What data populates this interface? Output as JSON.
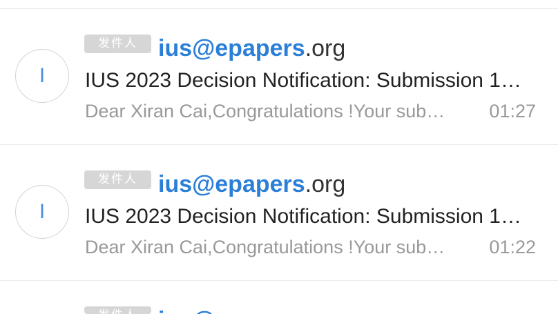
{
  "colors": {
    "accent": "#2b7fd8",
    "avatar_letter": "#4a8fdc",
    "avatar_border": "#d2d2d2",
    "badge_bg": "#d6d6d6",
    "subject_text": "#222222",
    "sender_rest": "#333333",
    "muted_text": "#999999",
    "divider": "#ebebeb"
  },
  "emails": [
    {
      "avatar_letter": "I",
      "badge": "发件人",
      "sender_highlight": "ius@epapers",
      "sender_rest": ".org",
      "subject": "IUS 2023 Decision Notification: Submission 1…",
      "preview": "Dear Xiran Cai,Congratulations !Your sub…",
      "time": "01:27"
    },
    {
      "avatar_letter": "I",
      "badge": "发件人",
      "sender_highlight": "ius@epapers",
      "sender_rest": ".org",
      "subject": "IUS 2023 Decision Notification: Submission 1…",
      "preview": "Dear Xiran Cai,Congratulations !Your sub…",
      "time": "01:22"
    },
    {
      "badge": "发件人",
      "sender_highlight": "ius@epapers",
      "sender_rest": ".org"
    }
  ]
}
